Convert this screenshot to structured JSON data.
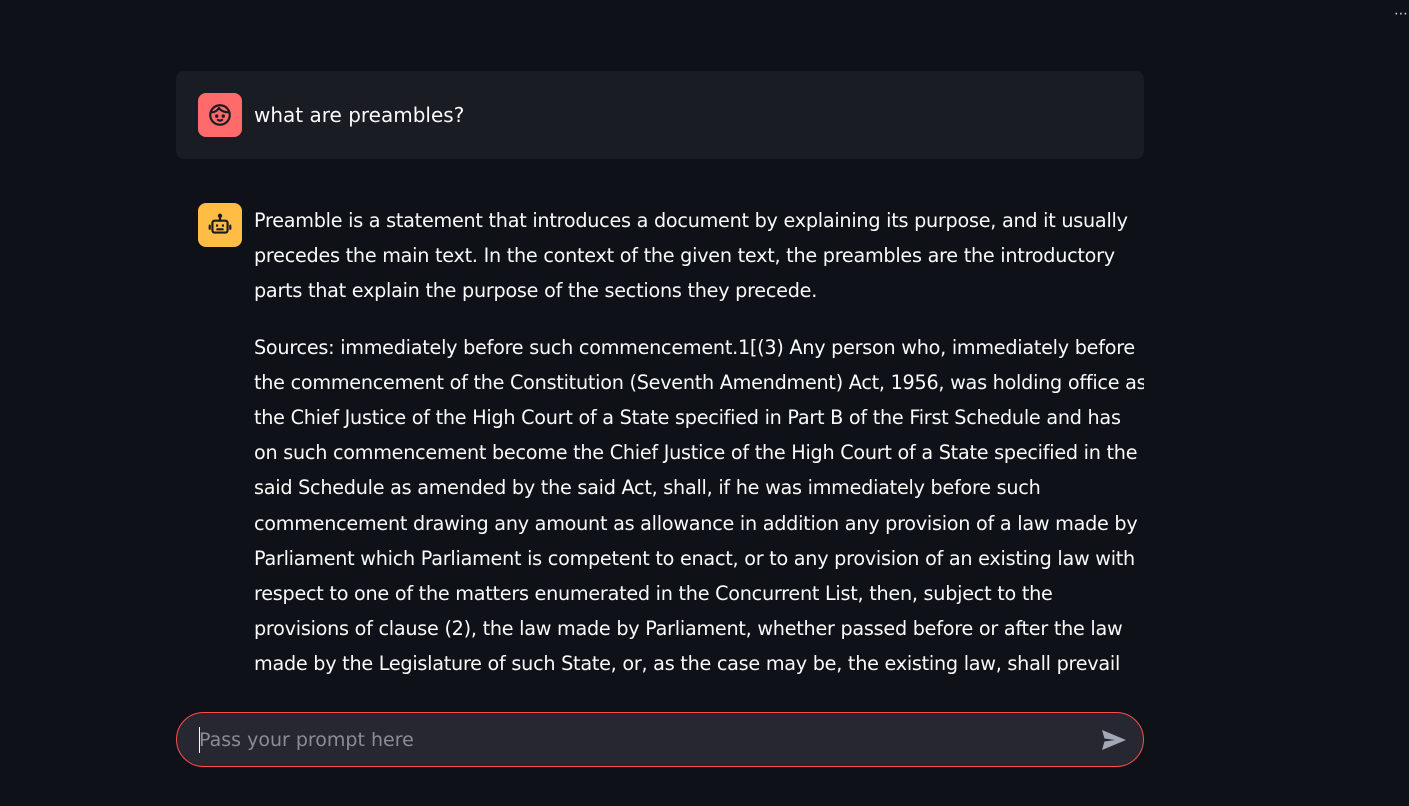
{
  "header": {
    "menu_icon": "ellipsis-icon",
    "menu_label": "⋯"
  },
  "chat": {
    "user_message": {
      "avatar_icon": "user-face-icon",
      "avatar_color": "#ff6b6b",
      "text": "what are preambles?"
    },
    "assistant_message": {
      "avatar_icon": "robot-icon",
      "avatar_color": "#ffbd45",
      "paragraphs": [
        "Preamble is a statement that introduces a document by explaining its purpose, and it usually precedes the main text. In the context of the given text, the preambles are the introductory parts that explain the purpose of the sections they precede.",
        "Sources: immediately before such commencement.1[(3) Any person who, immediately before the commencement of the Constitution (Seventh Amendment) Act, 1956, was holding office as the Chief Justice of the High Court of a State specified in Part B of the First Schedule and has on such commencement become the Chief Justice of the High Court of a State specified in the said Schedule as amended by the said Act, shall, if he was immediately before such commencement drawing any amount as allowance in addition any provision of a law made by Parliament which Parliament is competent to enact, or to any provision of an existing law with respect to one of the matters enumerated in the Concurrent List, then, subject to the provisions of clause (2), the law made by Parliament, whether passed before or after the law made by the Legislature of such State, or, as the case may be, the existing law, shall prevail and the law made by the Legislature of the"
      ]
    }
  },
  "input": {
    "placeholder": "Pass your prompt here",
    "value": "",
    "send_icon": "send-arrow-icon",
    "border_color": "#ff4b4b"
  },
  "colors": {
    "background": "#0e1117",
    "user_bubble": "#1a1c24",
    "input_bg": "#262730"
  }
}
